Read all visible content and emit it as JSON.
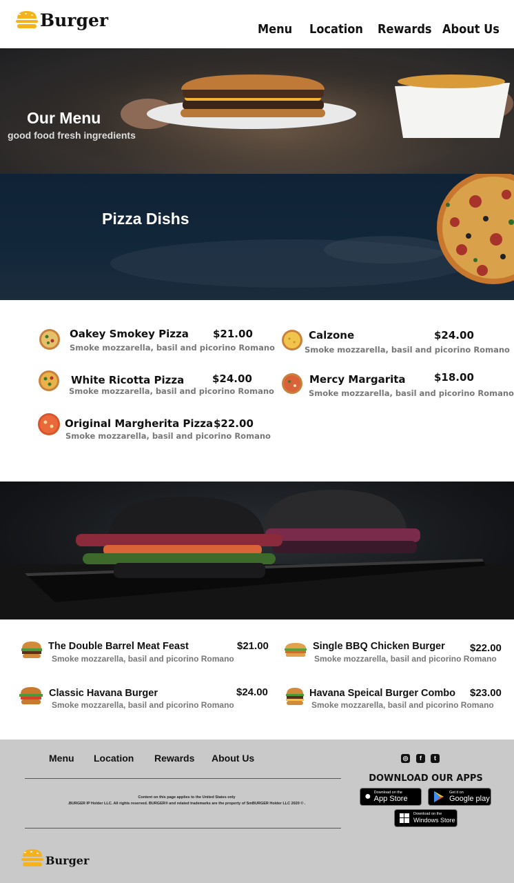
{
  "header": {
    "brand": "Burger",
    "nav": [
      "Menu",
      "Location",
      "Rewards",
      "About Us"
    ]
  },
  "hero": {
    "title": "Our Menu",
    "subtitle": "good food fresh ingredients"
  },
  "pizza_section": {
    "title": "Pizza Dishs",
    "items": [
      {
        "name": "Oakey Smokey Pizza",
        "price": "$21.00",
        "desc": "Smoke mozzarella, basil and picorino Romano"
      },
      {
        "name": "Calzone",
        "price": "$24.00",
        "desc": "Smoke mozzarella, basil and picorino Romano"
      },
      {
        "name": "White Ricotta Pizza",
        "price": "$24.00",
        "desc": "Smoke mozzarella, basil and picorino Romano"
      },
      {
        "name": "Mercy Margarita",
        "price": "$18.00",
        "desc": "Smoke mozzarella, basil and picorino Romano"
      },
      {
        "name": "Original Margherita Pizza",
        "price": "$22.00",
        "desc": "Smoke mozzarella, basil and picorino Romano"
      }
    ]
  },
  "burger_section": {
    "items": [
      {
        "name": "The Double Barrel Meat Feast",
        "price": "$21.00",
        "desc": "Smoke mozzarella, basil and picorino Romano"
      },
      {
        "name": "Single BBQ Chicken Burger",
        "price": "$22.00",
        "desc": "Smoke mozzarella, basil and picorino Romano"
      },
      {
        "name": "Classic Havana Burger",
        "price": "$24.00",
        "desc": "Smoke mozzarella, basil and picorino Romano"
      },
      {
        "name": "Havana Speical Burger Combo",
        "price": "$23.00",
        "desc": "Smoke mozzarella, basil and picorino Romano"
      }
    ]
  },
  "footer": {
    "nav": [
      "Menu",
      "Location",
      "Rewards",
      "About Us"
    ],
    "legal_line1": "Content on this page applies to the United States only",
    "legal_line2": ".BURGER IP Holder LLC. All rights reserved. BURGER® and related trademarks are the property of SmBURGER  Holder LLC 2020 © .",
    "download_title": "DOWNLOAD OUR APPS",
    "app_store": {
      "small": "Download on the",
      "big": "App Store"
    },
    "google_play": {
      "small": "Get it on",
      "big": "Google play"
    },
    "windows_store": {
      "small": "Download on the",
      "big": "Windows Store"
    },
    "brand": "Burger",
    "social_icons": [
      "instagram-icon",
      "facebook-icon",
      "twitter-icon"
    ]
  },
  "colors": {
    "accent": "#f6b21c",
    "footer_bg": "#c9c9c9",
    "banner_dark": "#13273b"
  }
}
